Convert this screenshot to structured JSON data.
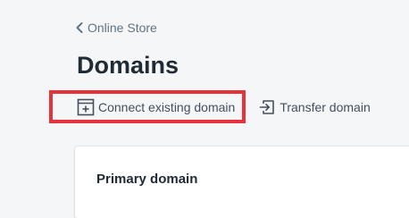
{
  "breadcrumb": {
    "label": "Online Store",
    "icon": "chevron-left-icon"
  },
  "page": {
    "title": "Domains"
  },
  "actions": {
    "connect_label": "Connect existing domain",
    "connect_icon": "connect-domain-icon",
    "transfer_label": "Transfer domain",
    "transfer_icon": "transfer-icon"
  },
  "card": {
    "title": "Primary domain"
  },
  "colors": {
    "background": "#f4f6f8",
    "text_primary": "#212b36",
    "text_secondary": "#637381",
    "highlight": "#e8323a",
    "card_bg": "#ffffff"
  }
}
